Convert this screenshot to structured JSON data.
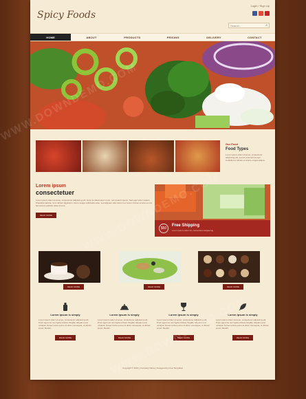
{
  "header": {
    "logo": "Spicy Foods",
    "login": "Login / Sign Up",
    "search_placeholder": "Search..."
  },
  "nav": {
    "items": [
      "HOME",
      "ABOUT",
      "PRODUCTS",
      "PRICING",
      "DELIVERY",
      "CONTACT"
    ]
  },
  "food_types": {
    "title": "Our Food",
    "subtitle": "Food Types",
    "text": "Lorem ipsum dolor sit amet, consectetur adipiscing elit, sed do eiusmod tempor incididunt ut labore et dolore magna aliqua."
  },
  "lorem_block": {
    "title": "Lorem ipsum",
    "subtitle": "consectetuer",
    "text": "Lorem ipsum dolor sit amet, consectetur adipiscing elit. Nunc et ullamcorper nunc, nec pretium ipsum. Sed eget tortor sapien. Phasellus lacinia, mi in dictum dignissim, lorem neque sollicitudin ante, sed aliquam odio lorem nec lorem. Donec et arcu et orci fermentum porttitor vitae id eros.",
    "button": "READ MORE"
  },
  "ship": {
    "price": "$50",
    "title": "Free Shipping",
    "text": "Lorem ipsum dolor sit, consectetur adipiscing"
  },
  "cards": [
    {
      "button": "READ MORE"
    },
    {
      "button": "READ MORE"
    },
    {
      "button": "READ MORE"
    }
  ],
  "features": [
    {
      "title": "Lorem Ipsum is simply",
      "text": "Lorem ipsum dolor sit amet, consectetur adipiscing elit. Proin eget nisi non ligula ultrices fringilla. Aliquam erat volutpat. Donec luctus purus id dolor consequat, ut dictum ipsum blandit.",
      "button": "READ MORE"
    },
    {
      "title": "Lorem Ipsum is simply",
      "text": "Lorem ipsum dolor sit amet, consectetur adipiscing elit. Proin eget nisi non ligula ultrices fringilla. Aliquam erat volutpat. Donec luctus purus id dolor consequat, ut dictum ipsum blandit.",
      "button": "READ MORE"
    },
    {
      "title": "Lorem Ipsum is simply",
      "text": "Lorem ipsum dolor sit amet, consectetur adipiscing elit. Proin eget nisi non ligula ultrices fringilla. Aliquam erat volutpat. Donec luctus purus id dolor consequat, ut dictum ipsum blandit.",
      "button": "READ MORE"
    },
    {
      "title": "Lorem Ipsum is simply",
      "text": "Lorem ipsum dolor sit amet, consectetur adipiscing elit. Proin eget nisi non ligula ultrices fringilla. Aliquam erat volutpat. Donec luctus purus id dolor consequat, ut dictum ipsum blandit.",
      "button": "READ MORE"
    }
  ],
  "footer": "Copyright © 2015 | Company Name | Designed by Free Templates",
  "watermark": "WWW.DOWNDEMO.COM",
  "colors": {
    "accent": "#a52820",
    "nav_active": "#222222",
    "page_bg": "#f6ebd5",
    "button": "#7a1d14"
  }
}
